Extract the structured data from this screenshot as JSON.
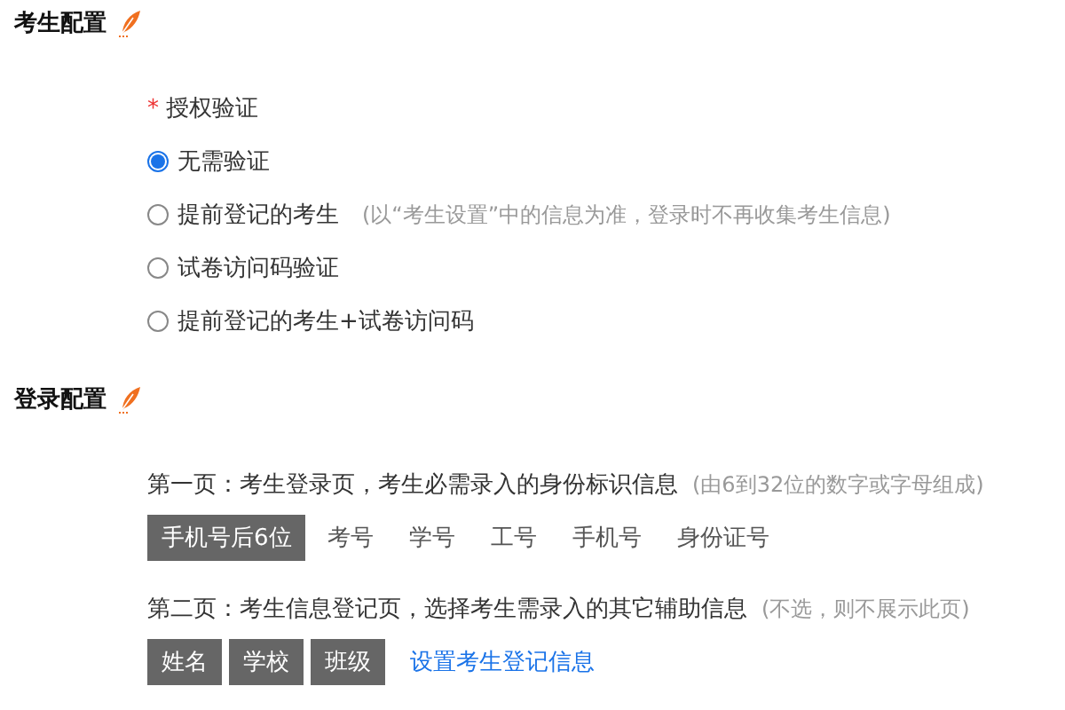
{
  "sections": [
    {
      "title": "考生配置",
      "kind": "auth",
      "field": {
        "label": "授权验证",
        "required_mark": "*"
      },
      "options": [
        {
          "label": "无需验证",
          "selected": true
        },
        {
          "label": "提前登记的考生",
          "hint": "(以“考生设置”中的信息为准，登录时不再收集考生信息)",
          "selected": false
        },
        {
          "label": "试卷访问码验证",
          "selected": false
        },
        {
          "label": "提前登记的考生+试卷访问码",
          "selected": false
        }
      ]
    },
    {
      "title": "登录配置",
      "kind": "login",
      "pages": [
        {
          "text": "第一页：考生登录页，考生必需录入的身份标识信息",
          "hint": "(由6到32位的数字或字母组成)",
          "tags": [
            {
              "label": "手机号后6位",
              "selected": true
            },
            {
              "label": "考号",
              "selected": false
            },
            {
              "label": "学号",
              "selected": false
            },
            {
              "label": "工号",
              "selected": false
            },
            {
              "label": "手机号",
              "selected": false
            },
            {
              "label": "身份证号",
              "selected": false
            }
          ]
        },
        {
          "text": "第二页：考生信息登记页，选择考生需录入的其它辅助信息",
          "hint": "(不选，则不展示此页)",
          "tags": [
            {
              "label": "姓名",
              "selected": true
            },
            {
              "label": "学校",
              "selected": true
            },
            {
              "label": "班级",
              "selected": true
            }
          ],
          "link": "设置考生登记信息"
        }
      ]
    }
  ]
}
